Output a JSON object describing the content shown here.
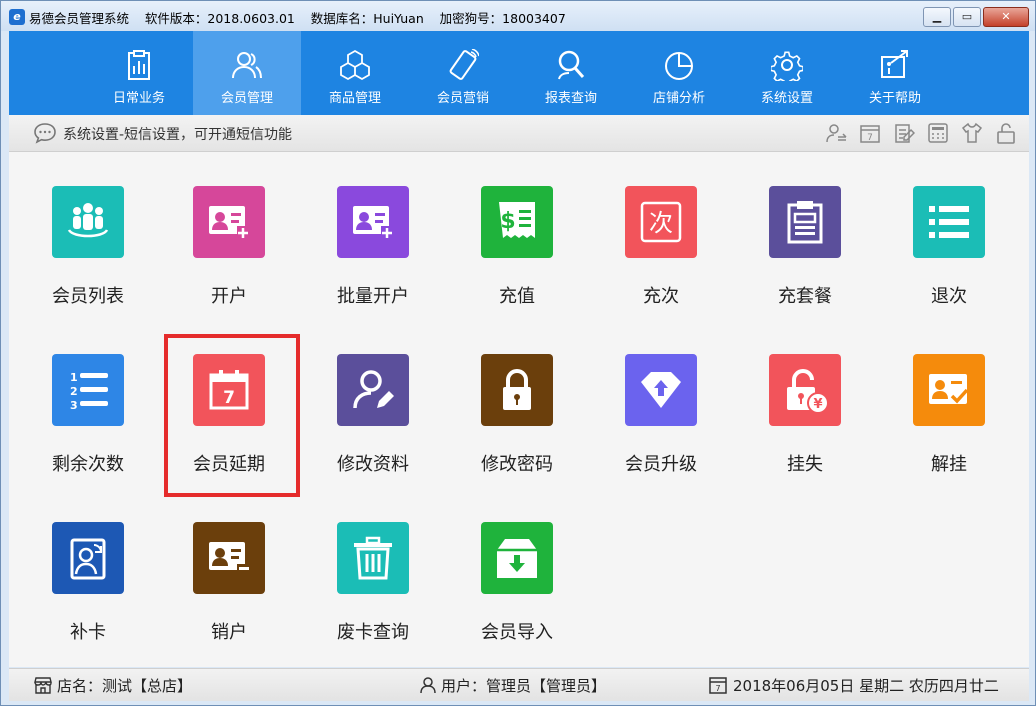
{
  "window": {
    "title": "易德会员管理系统    软件版本：2018.0603.01    数据库名：HuiYuan    加密狗号：18003407"
  },
  "nav": {
    "items": [
      {
        "label": "日常业务",
        "icon": "clipboard-chart-icon"
      },
      {
        "label": "会员管理",
        "icon": "users-icon",
        "active": true
      },
      {
        "label": "商品管理",
        "icon": "cubes-icon"
      },
      {
        "label": "会员营销",
        "icon": "phone-tag-icon"
      },
      {
        "label": "报表查询",
        "icon": "search-person-icon"
      },
      {
        "label": "店铺分析",
        "icon": "pie-chart-icon"
      },
      {
        "label": "系统设置",
        "icon": "gear-icon"
      },
      {
        "label": "关于帮助",
        "icon": "info-screen-icon"
      }
    ]
  },
  "infobar": {
    "text": "系统设置-短信设置，可开通短信功能"
  },
  "tiles": [
    {
      "label": "会员列表",
      "color": "#1bbdb6",
      "icon": "member-group-icon"
    },
    {
      "label": "开户",
      "color": "#d6479a",
      "icon": "card-add-icon"
    },
    {
      "label": "批量开户",
      "color": "#8a49dd",
      "icon": "card-add-icon"
    },
    {
      "label": "充值",
      "color": "#1fb33c",
      "icon": "receipt-dollar-icon"
    },
    {
      "label": "充次",
      "color": "#f2545b",
      "icon": "count-char-icon",
      "char": "次"
    },
    {
      "label": "充套餐",
      "color": "#5b4f9b",
      "icon": "clipboard-doc-icon"
    },
    {
      "label": "退次",
      "color": "#1bbdb6",
      "icon": "list-icon"
    },
    {
      "label": "剩余次数",
      "color": "#2e86e6",
      "icon": "numbered-list-icon"
    },
    {
      "label": "会员延期",
      "color": "#f2545b",
      "icon": "calendar-icon",
      "char": "7"
    },
    {
      "label": "修改资料",
      "color": "#5b4f9b",
      "icon": "user-edit-icon"
    },
    {
      "label": "修改密码",
      "color": "#6b3f0c",
      "icon": "lock-icon"
    },
    {
      "label": "会员升级",
      "color": "#6b63ee",
      "icon": "diamond-up-icon"
    },
    {
      "label": "挂失",
      "color": "#f2545b",
      "icon": "unlock-yen-icon",
      "char": "¥"
    },
    {
      "label": "解挂",
      "color": "#f58b0c",
      "icon": "card-check-icon"
    },
    {
      "label": "补卡",
      "color": "#1d58b4",
      "icon": "card-refresh-icon"
    },
    {
      "label": "销户",
      "color": "#6b3f0c",
      "icon": "card-remove-icon"
    },
    {
      "label": "废卡查询",
      "color": "#1bbdb6",
      "icon": "trash-icon"
    },
    {
      "label": "会员导入",
      "color": "#1fb33c",
      "icon": "import-box-icon"
    }
  ],
  "status": {
    "store": "店名：测试【总店】",
    "user": "用户：管理员【管理员】",
    "date": "2018年06月05日 星期二 农历四月廿二"
  }
}
